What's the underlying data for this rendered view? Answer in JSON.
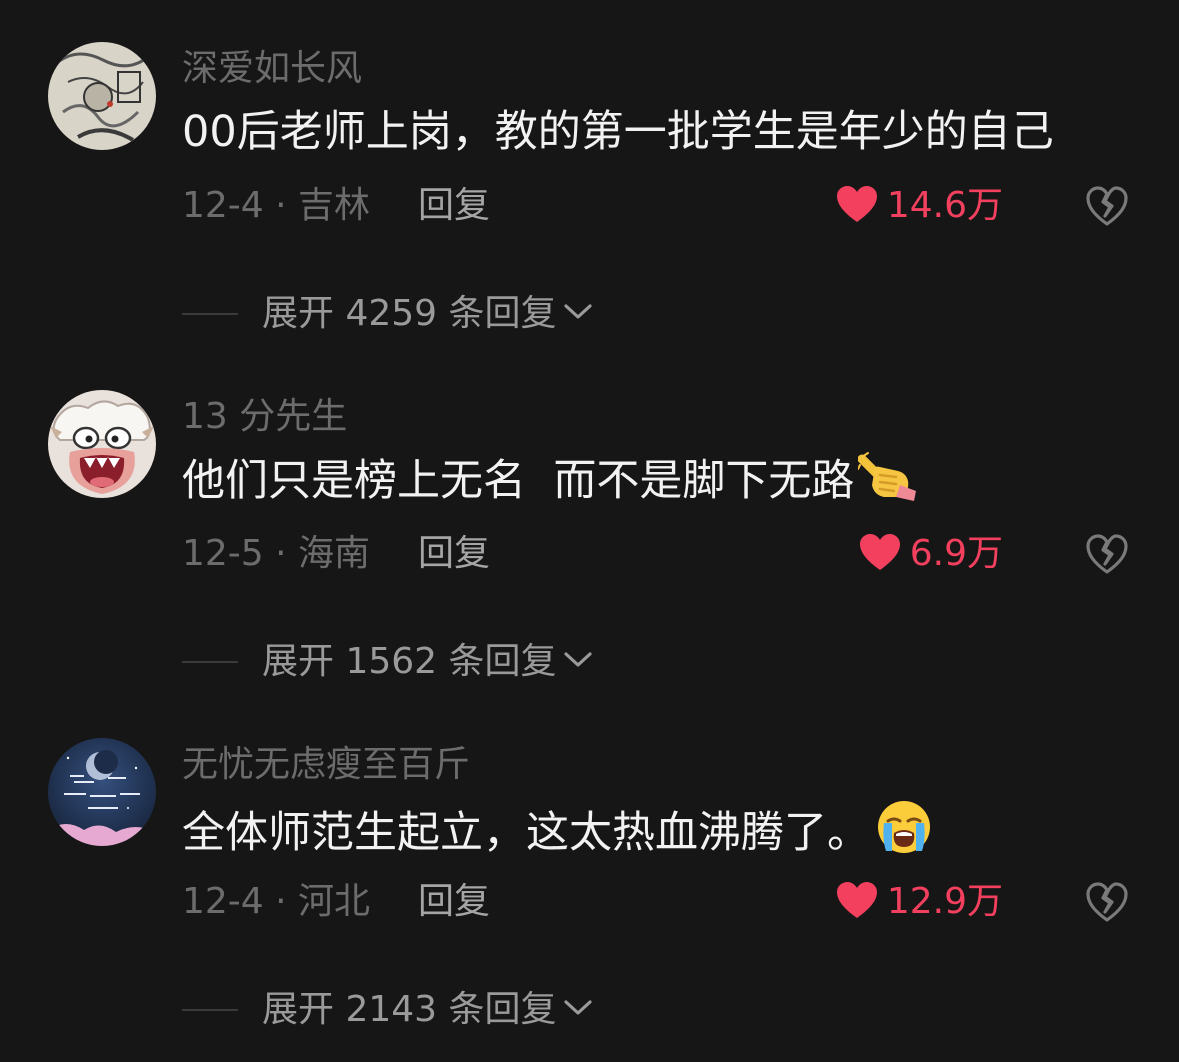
{
  "colors": {
    "background": "#161616",
    "like_red": "#f2405e",
    "muted_text": "#6c6c6c",
    "content_text": "#f2f2f2"
  },
  "comments": [
    {
      "username": "深爱如长风",
      "content": "00后老师上岗，教的第一批学生是年少的自己",
      "emoji": "",
      "date_location": "12-4 · 吉林",
      "reply_label": "回复",
      "likes": "14.6万",
      "expand_label": "展开 4259 条回复"
    },
    {
      "username": "13 分先生",
      "content": "他们只是榜上无名  而不是脚下无路",
      "emoji": "pointing-hand-emoji",
      "date_location": "12-5 · 海南",
      "reply_label": "回复",
      "likes": "6.9万",
      "expand_label": "展开 1562 条回复"
    },
    {
      "username": "无忧无虑瘦至百斤",
      "content": "全体师范生起立，这太热血沸腾了。",
      "emoji": "loudly-crying-face-emoji",
      "date_location": "12-4 · 河北",
      "reply_label": "回复",
      "likes": "12.9万",
      "expand_label": "展开 2143 条回复"
    }
  ]
}
